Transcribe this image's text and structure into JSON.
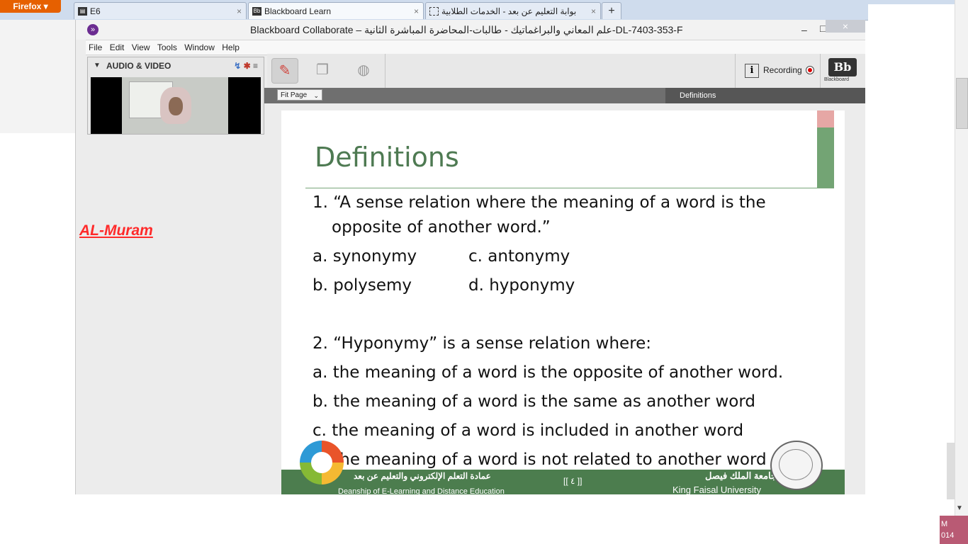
{
  "browser": {
    "menu_label": "Firefox ▾",
    "tabs": [
      {
        "label": "E6",
        "icon": "document-icon"
      },
      {
        "label": "Blackboard Learn",
        "icon": "bb-favicon"
      },
      {
        "label": "بوابة التعليم عن بعد - الخدمات الطلابية",
        "icon": "dotted-favicon"
      }
    ],
    "close_glyph": "×",
    "new_tab": "+"
  },
  "window": {
    "title": "Blackboard Collaborate – علم المعاني والبراغماتيك - طالبات-المحاضرة المباشرة الثانية-DL-7403-353-F",
    "minimize": "–",
    "maximize": "□",
    "close": "×"
  },
  "menu": [
    "File",
    "Edit",
    "View",
    "Tools",
    "Window",
    "Help"
  ],
  "av_panel": {
    "title": "AUDIO & VIDEO",
    "expand_glyph": "▼"
  },
  "toolbar": {
    "recording_label": "Recording",
    "info_glyph": "i",
    "bb_logo": "Bb",
    "bb_sub": "Blackboard"
  },
  "slide_bar": {
    "fit_label": "Fit Page",
    "dropdown_glyph": "⌄",
    "tab_label": "Definitions"
  },
  "slide": {
    "title": "Definitions",
    "lines": [
      "1. “A sense relation where the meaning of a word is the",
      "opposite of another word.”",
      "a. synonymy",
      "c. antonymy",
      "b. polysemy",
      "d. hyponymy",
      "2. “Hyponymy” is a sense relation where:",
      "a. the meaning of a word is the opposite of another word.",
      "b. the meaning of a word is the same as another word",
      "c. the meaning of a word is included in another word",
      "d. the meaning of a word is not related to another word"
    ],
    "footer": {
      "ar_left": "عمادة التعلم الإلكتروني والتعليم عن بعد",
      "en_left": "Deanship of E-Learning and Distance Education",
      "page": "[[ ٤ ]]",
      "ar_right": "جامعة الملك فيصل",
      "en_right": "King Faisal University"
    }
  },
  "overlay": {
    "watermark": "AL-Muram"
  },
  "taskbar": {
    "line1": "M",
    "line2": "014"
  }
}
